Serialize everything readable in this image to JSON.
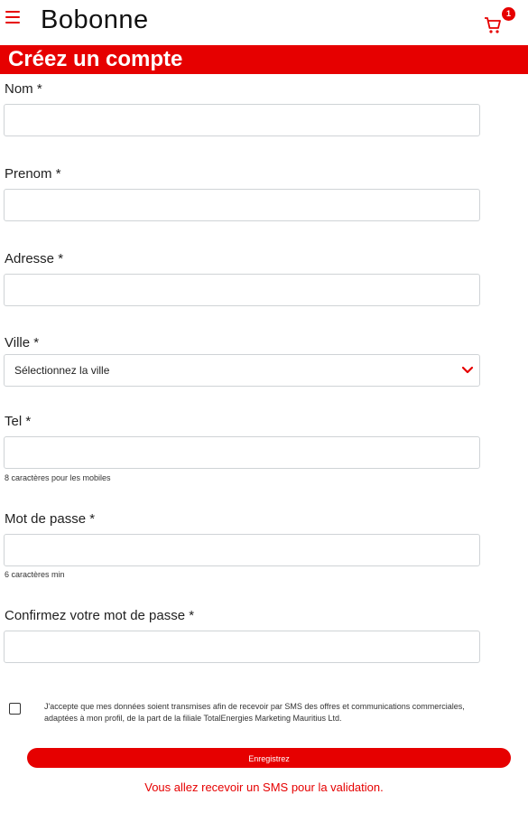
{
  "app": {
    "title": "Bobonne",
    "cart_count": "1"
  },
  "page": {
    "heading": "Créez un compte"
  },
  "form": {
    "nom": {
      "label": "Nom *",
      "value": ""
    },
    "prenom": {
      "label": "Prenom *",
      "value": ""
    },
    "adresse": {
      "label": "Adresse *",
      "value": ""
    },
    "ville": {
      "label": "Ville *",
      "selected": "Sélectionnez la ville"
    },
    "tel": {
      "label": "Tel *",
      "value": "",
      "hint": "8 caractères pour les mobiles"
    },
    "password": {
      "label": "Mot de passe *",
      "value": "",
      "hint": "6 caractères min"
    },
    "confirm": {
      "label": "Confirmez votre mot de passe *",
      "value": ""
    },
    "consent": {
      "checked": false,
      "text": "J'accepte que mes données soient transmises afin de recevoir par SMS des offres et communications commerciales, adaptées à mon profil, de la part de la filiale TotalEnergies Marketing Mauritius Ltd."
    },
    "submit_label": "Enregistrez",
    "sms_note": "Vous allez recevoir un SMS pour la validation."
  },
  "colors": {
    "accent": "#e60000"
  },
  "icons": {
    "menu": "hamburger-icon",
    "cart": "cart-icon",
    "chevron": "chevron-down-icon"
  }
}
